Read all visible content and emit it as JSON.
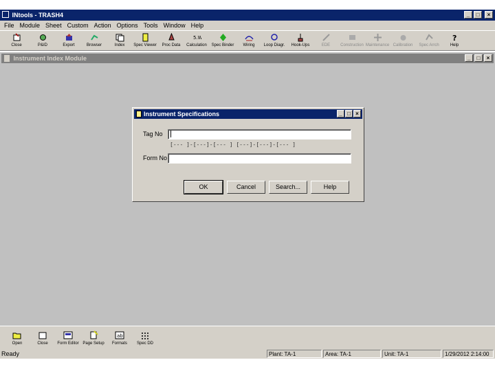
{
  "window": {
    "title": "INtools - TRASH4"
  },
  "menu": [
    "File",
    "Module",
    "Sheet",
    "Custom",
    "Action",
    "Options",
    "Tools",
    "Window",
    "Help"
  ],
  "toolbar": [
    {
      "label": "Close",
      "icon": "close-doc-icon",
      "enabled": true
    },
    {
      "label": "P&ID",
      "icon": "pid-icon",
      "enabled": true
    },
    {
      "label": "Export",
      "icon": "export-icon",
      "enabled": true
    },
    {
      "label": "Browser",
      "icon": "browser-icon",
      "enabled": true
    },
    {
      "label": "Index",
      "icon": "index-icon",
      "enabled": true
    },
    {
      "label": "Spec Viewer",
      "icon": "spec-viewer-icon",
      "enabled": true
    },
    {
      "label": "Proc Data",
      "icon": "process-data-icon",
      "enabled": true
    },
    {
      "label": "Calculation",
      "icon": "calculation-icon",
      "enabled": true
    },
    {
      "label": "Spec Binder",
      "icon": "spec-binder-icon",
      "enabled": true
    },
    {
      "label": "Wiring",
      "icon": "wiring-icon",
      "enabled": true
    },
    {
      "label": "Loop Diagr.",
      "icon": "loop-diagram-icon",
      "enabled": true
    },
    {
      "label": "Hook-Ups",
      "icon": "hook-ups-icon",
      "enabled": true
    },
    {
      "label": "EDE",
      "icon": "ede-icon",
      "enabled": false
    },
    {
      "label": "Construction",
      "icon": "construction-icon",
      "enabled": false
    },
    {
      "label": "Maintenance",
      "icon": "maintenance-icon",
      "enabled": false
    },
    {
      "label": "Calibration",
      "icon": "calibration-icon",
      "enabled": false
    },
    {
      "label": "Spec Arrch",
      "icon": "spec-archive-icon",
      "enabled": false
    },
    {
      "label": "Help",
      "icon": "help-icon",
      "enabled": true
    }
  ],
  "child_window": {
    "title": "Instrument Index Module"
  },
  "dialog": {
    "title": "Instrument Specifications",
    "tag_label": "Tag No",
    "tag_value": "",
    "mask": "[--- ]-[---]-[--- ] [---]-[---]-[--- ]",
    "form_label": "Form No",
    "form_value": "",
    "buttons": {
      "ok": "OK",
      "cancel": "Cancel",
      "search": "Search...",
      "help": "Help"
    }
  },
  "bottom_toolbar": [
    {
      "label": "Open",
      "icon": "open-icon"
    },
    {
      "label": "Close",
      "icon": "close-icon"
    },
    {
      "label": "Form Editor",
      "icon": "form-editor-icon"
    },
    {
      "label": "Page Setup",
      "icon": "page-setup-icon"
    },
    {
      "label": "Formats",
      "icon": "formats-icon"
    },
    {
      "label": "Spec DD",
      "icon": "spec-dd-icon"
    }
  ],
  "status": {
    "ready": "Ready",
    "plant": "Plant: TA-1",
    "area": "Area: TA-1",
    "unit": "Unit: TA-1",
    "date": "1/29/2012 2:14:00"
  }
}
